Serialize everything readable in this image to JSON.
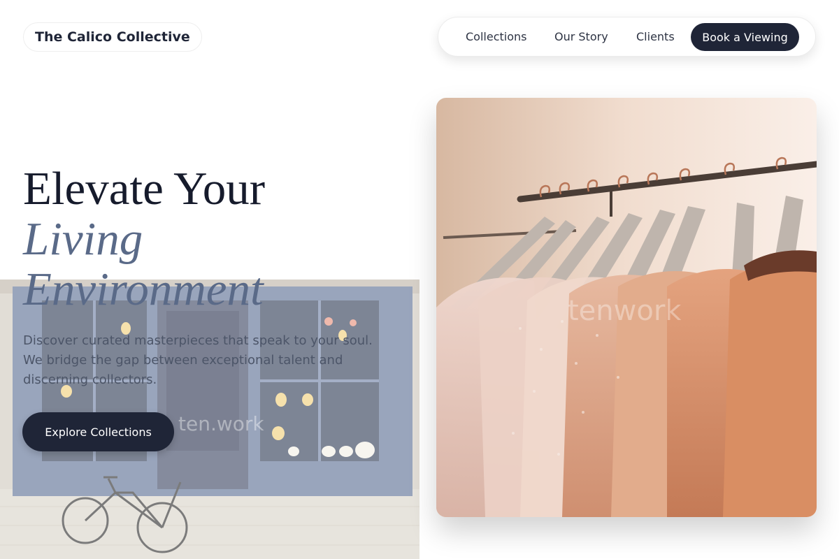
{
  "header": {
    "logo": "The Calico Collective",
    "nav": [
      "Collections",
      "Our Story",
      "Clients"
    ],
    "cta": "Book a Viewing"
  },
  "hero": {
    "title_line1": "Elevate Your",
    "title_line2": "Living",
    "title_line3": "Environment",
    "description": "Discover curated masterpieces that speak to your soul. We bridge the gap between exceptional talent and discerning collectors.",
    "button": "Explore Collections"
  },
  "images": {
    "storefront": "storefront-photo",
    "rack": "clothing-rack-photo",
    "watermark_left": "ten.work",
    "watermark_right": "tenwork"
  },
  "colors": {
    "primary_dark": "#1f2537",
    "accent_slate": "#5a6a88",
    "text_muted": "#4c5568"
  }
}
